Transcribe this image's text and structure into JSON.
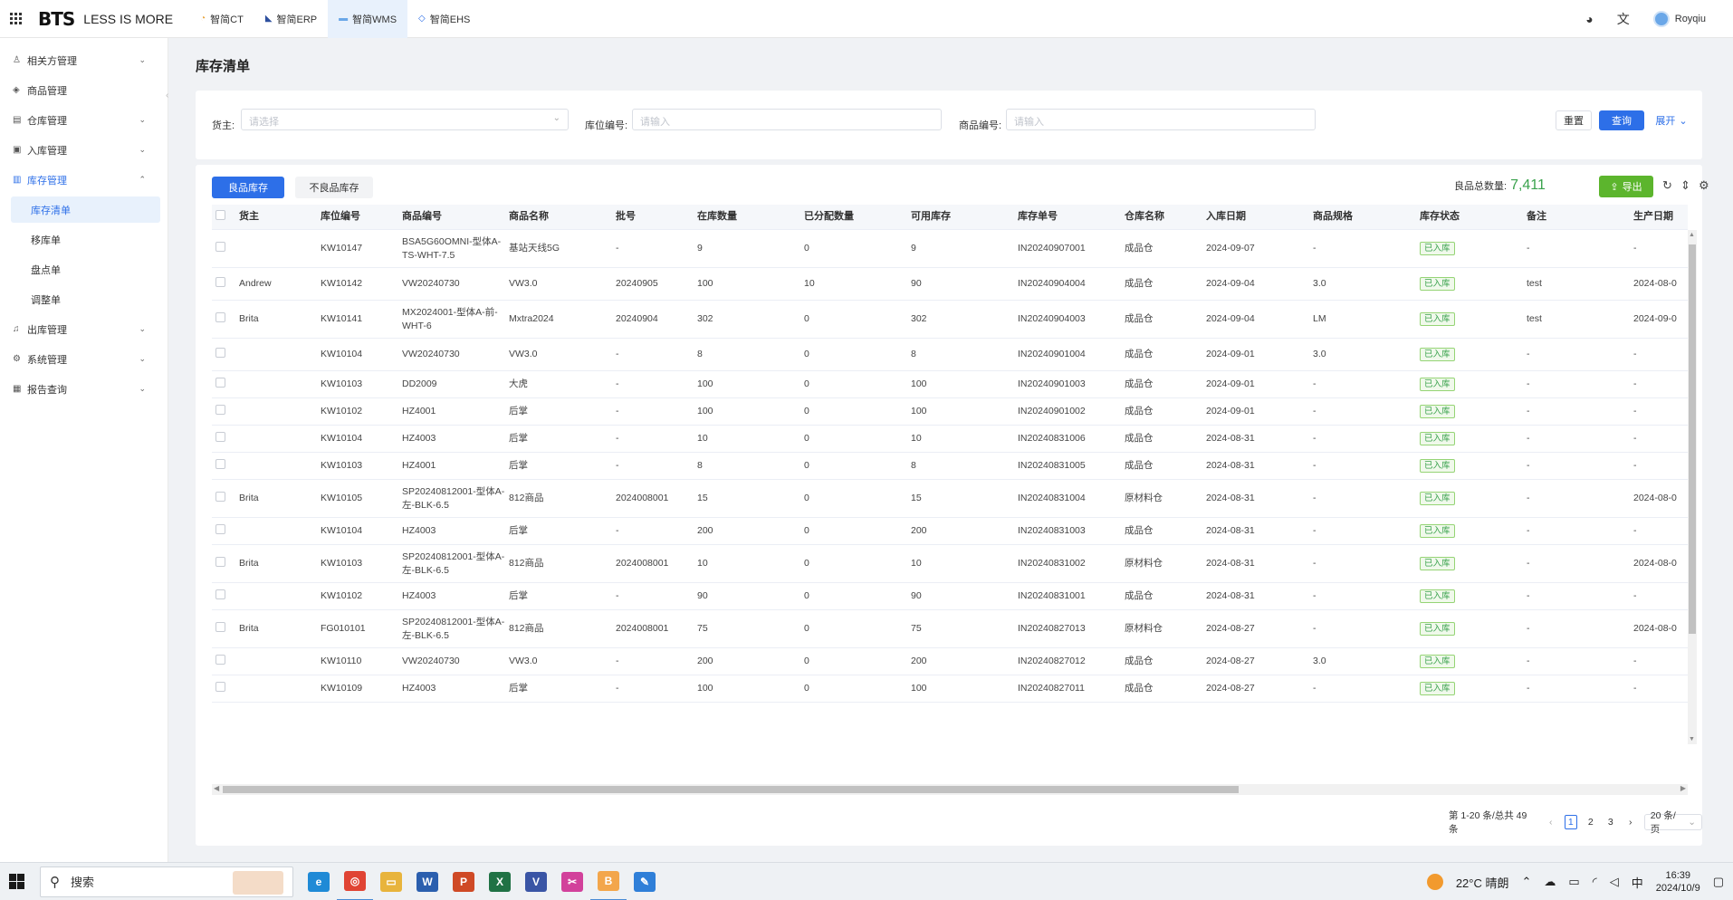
{
  "topbar": {
    "logo_mark": "BTS",
    "slogan": "LESS IS MORE",
    "apps": [
      {
        "label": "智简CT",
        "icon": "ct-icon"
      },
      {
        "label": "智简ERP",
        "icon": "erp-icon"
      },
      {
        "label": "智简WMS",
        "icon": "wms-icon"
      },
      {
        "label": "智简EHS",
        "icon": "ehs-icon"
      }
    ],
    "active_app": "智简WMS",
    "username": "Royqiu",
    "icons": [
      "apps-grid-icon",
      "wechat-icon",
      "translate-icon",
      "user-avatar-icon"
    ]
  },
  "sidebar": {
    "items": [
      {
        "label": "相关方管理",
        "icon": "person-icon",
        "expandable": true
      },
      {
        "label": "商品管理",
        "icon": "tag-icon",
        "expandable": false
      },
      {
        "label": "仓库管理",
        "icon": "warehouse-icon",
        "expandable": true
      },
      {
        "label": "入库管理",
        "icon": "inbound-icon",
        "expandable": true
      },
      {
        "label": "库存管理",
        "icon": "inventory-icon",
        "expandable": true,
        "open": true
      },
      {
        "label": "出库管理",
        "icon": "bell-icon",
        "expandable": true
      },
      {
        "label": "系统管理",
        "icon": "gear-icon",
        "expandable": true
      },
      {
        "label": "报告查询",
        "icon": "report-icon",
        "expandable": true
      }
    ],
    "submenu": [
      "库存清单",
      "移库单",
      "盘点单",
      "调整单"
    ],
    "active_sub": "库存清单"
  },
  "page": {
    "title": "库存清单"
  },
  "filters": {
    "owner_label": "货主:",
    "owner_placeholder": "请选择",
    "location_label": "库位编号:",
    "location_placeholder": "请输入",
    "product_label": "商品编号:",
    "product_placeholder": "请输入",
    "reset_label": "重置",
    "query_label": "查询",
    "expand_label": "展开"
  },
  "table_toolbar": {
    "tab_good": "良品库存",
    "tab_bad": "不良品库存",
    "total_label": "良品总数量:",
    "total_value": "7,411",
    "export_label": "导出"
  },
  "table": {
    "headers": [
      "货主",
      "库位编号",
      "商品编号",
      "商品名称",
      "批号",
      "在库数量",
      "已分配数量",
      "可用库存",
      "库存单号",
      "仓库名称",
      "入库日期",
      "商品规格",
      "库存状态",
      "备注",
      "生产日期"
    ],
    "rows": [
      [
        "",
        "KW10147",
        "BSA5G60OMNI-型体A-TS-WHT-7.5",
        "基站天线5G",
        "-",
        "9",
        "0",
        "9",
        "IN20240907001",
        "成品仓",
        "2024-09-07",
        "-",
        "已入库",
        "-",
        "-"
      ],
      [
        "Andrew",
        "KW10142",
        "VW20240730",
        "VW3.0",
        "20240905",
        "100",
        "10",
        "90",
        "IN20240904004",
        "成品仓",
        "2024-09-04",
        "3.0",
        "已入库",
        "test",
        "2024-08-0"
      ],
      [
        "Brita",
        "KW10141",
        "MX2024001-型体A-前-WHT-6",
        "Mxtra2024",
        "20240904",
        "302",
        "0",
        "302",
        "IN20240904003",
        "成品仓",
        "2024-09-04",
        "LM",
        "已入库",
        "test",
        "2024-09-0"
      ],
      [
        "",
        "KW10104",
        "VW20240730",
        "VW3.0",
        "-",
        "8",
        "0",
        "8",
        "IN20240901004",
        "成品仓",
        "2024-09-01",
        "3.0",
        "已入库",
        "-",
        "-"
      ],
      [
        "",
        "KW10103",
        "DD2009",
        "大虎",
        "-",
        "100",
        "0",
        "100",
        "IN20240901003",
        "成品仓",
        "2024-09-01",
        "-",
        "已入库",
        "-",
        "-"
      ],
      [
        "",
        "KW10102",
        "HZ4001",
        "后掌",
        "-",
        "100",
        "0",
        "100",
        "IN20240901002",
        "成品仓",
        "2024-09-01",
        "-",
        "已入库",
        "-",
        "-"
      ],
      [
        "",
        "KW10104",
        "HZ4003",
        "后掌",
        "-",
        "10",
        "0",
        "10",
        "IN20240831006",
        "成品仓",
        "2024-08-31",
        "-",
        "已入库",
        "-",
        "-"
      ],
      [
        "",
        "KW10103",
        "HZ4001",
        "后掌",
        "-",
        "8",
        "0",
        "8",
        "IN20240831005",
        "成品仓",
        "2024-08-31",
        "-",
        "已入库",
        "-",
        "-"
      ],
      [
        "Brita",
        "KW10105",
        "SP20240812001-型体A-左-BLK-6.5",
        "812商品",
        "2024008001",
        "15",
        "0",
        "15",
        "IN20240831004",
        "原材料仓",
        "2024-08-31",
        "-",
        "已入库",
        "-",
        "2024-08-0"
      ],
      [
        "",
        "KW10104",
        "HZ4003",
        "后掌",
        "-",
        "200",
        "0",
        "200",
        "IN20240831003",
        "成品仓",
        "2024-08-31",
        "-",
        "已入库",
        "-",
        "-"
      ],
      [
        "Brita",
        "KW10103",
        "SP20240812001-型体A-左-BLK-6.5",
        "812商品",
        "2024008001",
        "10",
        "0",
        "10",
        "IN20240831002",
        "原材料仓",
        "2024-08-31",
        "-",
        "已入库",
        "-",
        "2024-08-0"
      ],
      [
        "",
        "KW10102",
        "HZ4003",
        "后掌",
        "-",
        "90",
        "0",
        "90",
        "IN20240831001",
        "成品仓",
        "2024-08-31",
        "-",
        "已入库",
        "-",
        "-"
      ],
      [
        "Brita",
        "FG010101",
        "SP20240812001-型体A-左-BLK-6.5",
        "812商品",
        "2024008001",
        "75",
        "0",
        "75",
        "IN20240827013",
        "原材料仓",
        "2024-08-27",
        "-",
        "已入库",
        "-",
        "2024-08-0"
      ],
      [
        "",
        "KW10110",
        "VW20240730",
        "VW3.0",
        "-",
        "200",
        "0",
        "200",
        "IN20240827012",
        "成品仓",
        "2024-08-27",
        "3.0",
        "已入库",
        "-",
        "-"
      ],
      [
        "",
        "KW10109",
        "HZ4003",
        "后掌",
        "-",
        "100",
        "0",
        "100",
        "IN20240827011",
        "成品仓",
        "2024-08-27",
        "-",
        "已入库",
        "-",
        "-"
      ]
    ]
  },
  "pagination": {
    "summary": "第 1-20 条/总共 49 条",
    "pages": [
      "1",
      "2",
      "3"
    ],
    "current": "1",
    "page_size": "20 条/页"
  },
  "taskbar": {
    "search_label": "搜索",
    "weather": "22°C 晴朗",
    "ime": "中",
    "time": "16:39",
    "date": "2024/10/9",
    "apps": [
      {
        "name": "edge-icon",
        "color": "#1f8ad6",
        "glyph": "e"
      },
      {
        "name": "chrome-icon",
        "color": "#e04434",
        "glyph": "◎"
      },
      {
        "name": "file-explorer-icon",
        "color": "#e8b43c",
        "glyph": "▭"
      },
      {
        "name": "word-icon",
        "color": "#2b5fae",
        "glyph": "W"
      },
      {
        "name": "powerpoint-icon",
        "color": "#cf4a26",
        "glyph": "P"
      },
      {
        "name": "excel-icon",
        "color": "#207245",
        "glyph": "X"
      },
      {
        "name": "visio-icon",
        "color": "#3a55a5",
        "glyph": "V"
      },
      {
        "name": "snipping-icon",
        "color": "#d2419b",
        "glyph": "✂"
      },
      {
        "name": "bts-app-icon",
        "color": "#f3a64b",
        "glyph": "B"
      },
      {
        "name": "paint-icon",
        "color": "#2f7fd8",
        "glyph": "✎"
      }
    ]
  }
}
